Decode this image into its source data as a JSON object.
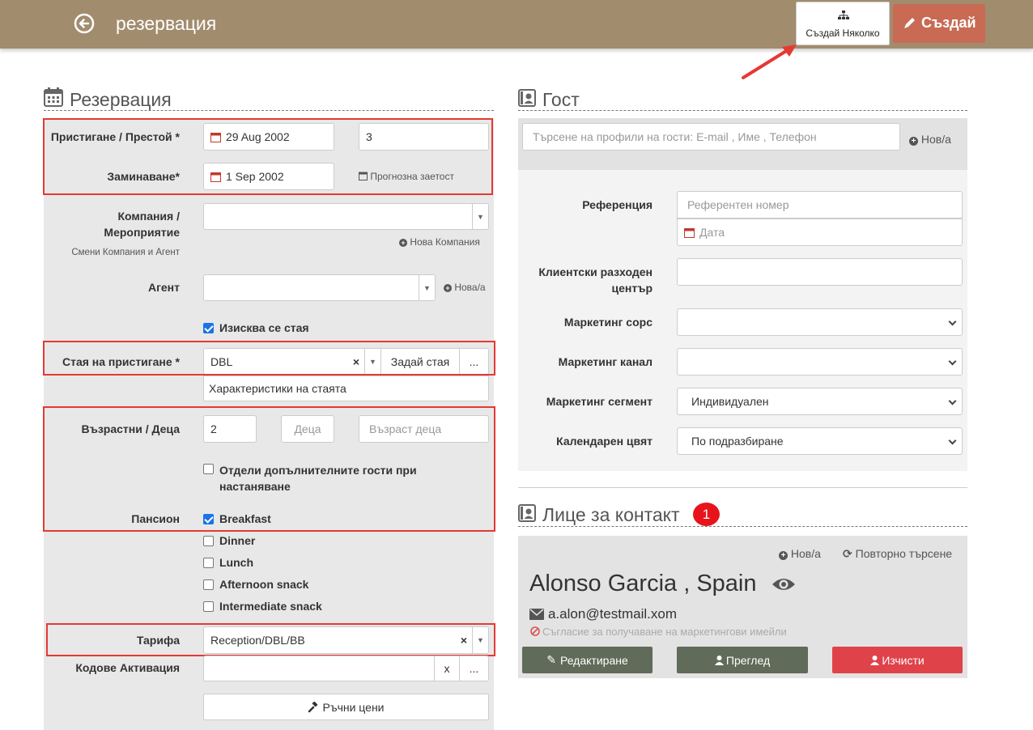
{
  "header": {
    "title": "резервация",
    "create_multiple_label": "Създай Няколко",
    "create_label": "Създай"
  },
  "reservation": {
    "section_title": "Резервация",
    "arrival_stay_label": "Пристигане / Престой *",
    "arrival_date": "29 Aug 2002",
    "nights": "3",
    "departure_label": "Заминаване*",
    "departure_date": "1 Sep 2002",
    "forecast_link": "Прогнозна заетост",
    "company_label_1": "Компания /",
    "company_label_2": "Мероприятие",
    "change_company_link": "Смени Компания и Агент",
    "new_company_link": "Нова Компания",
    "agent_label": "Агент",
    "new_agent_link": "Нова/а",
    "room_required_label": "Изисква се стая",
    "room_arrival_label": "Стая на пристигане *",
    "room_type": "DBL",
    "clear_x": "×",
    "assign_room_label": "Задай стая",
    "more_label": "...",
    "room_features_value": "Характеристики на стаята",
    "adults_children_label": "Възрастни / Деца",
    "adults": "2",
    "children_placeholder": "Деца",
    "children_age_placeholder": "Възраст деца",
    "separate_guests_line1": "Отдели допълнителните гости при",
    "separate_guests_line2": "настаняване",
    "board_label": "Пансион",
    "meals": [
      "Breakfast",
      "Dinner",
      "Lunch",
      "Afternoon snack",
      "Intermediate snack"
    ],
    "rate_label": "Тарифа",
    "rate_value": "Reception/DBL/BB",
    "activation_codes_label": "Кодове Активация",
    "activation_x": "x",
    "manual_prices_label": "Ръчни цени"
  },
  "guest": {
    "section_title": "Гост",
    "search_placeholder": "Търсене на профили на гости: E-mail , Име , Телефон",
    "new_link": "Нов/а",
    "reference_label": "Референция",
    "reference_placeholder": "Референтен номер",
    "date_placeholder": "Дата",
    "cost_center_label_1": "Клиентски разходен",
    "cost_center_label_2": "център",
    "marketing_source_label": "Маркетинг сорс",
    "marketing_channel_label": "Маркетинг канал",
    "marketing_segment_label": "Маркетинг сегмент",
    "marketing_segment_value": "Индивидуален",
    "calendar_color_label": "Календарен цвят",
    "calendar_color_value": "По подразбиране"
  },
  "contact": {
    "section_title": "Лице за контакт",
    "badge": "1",
    "new_link": "Нов/а",
    "research_link": "Повторно търсене",
    "name": "Alonso Garcia , Spain",
    "email": "a.alon@testmail.xom",
    "consent_text": "Съгласие за получаване на маркетингови имейли",
    "edit_label": "Редактиране",
    "view_label": "Преглед",
    "clear_label": "Изчисти"
  },
  "colors": {
    "header_bg": "#a28c6e",
    "create_btn": "#c86a54",
    "highlight_red": "#e53935",
    "dark_btn": "#606b59",
    "clear_btn": "#e0424a"
  }
}
